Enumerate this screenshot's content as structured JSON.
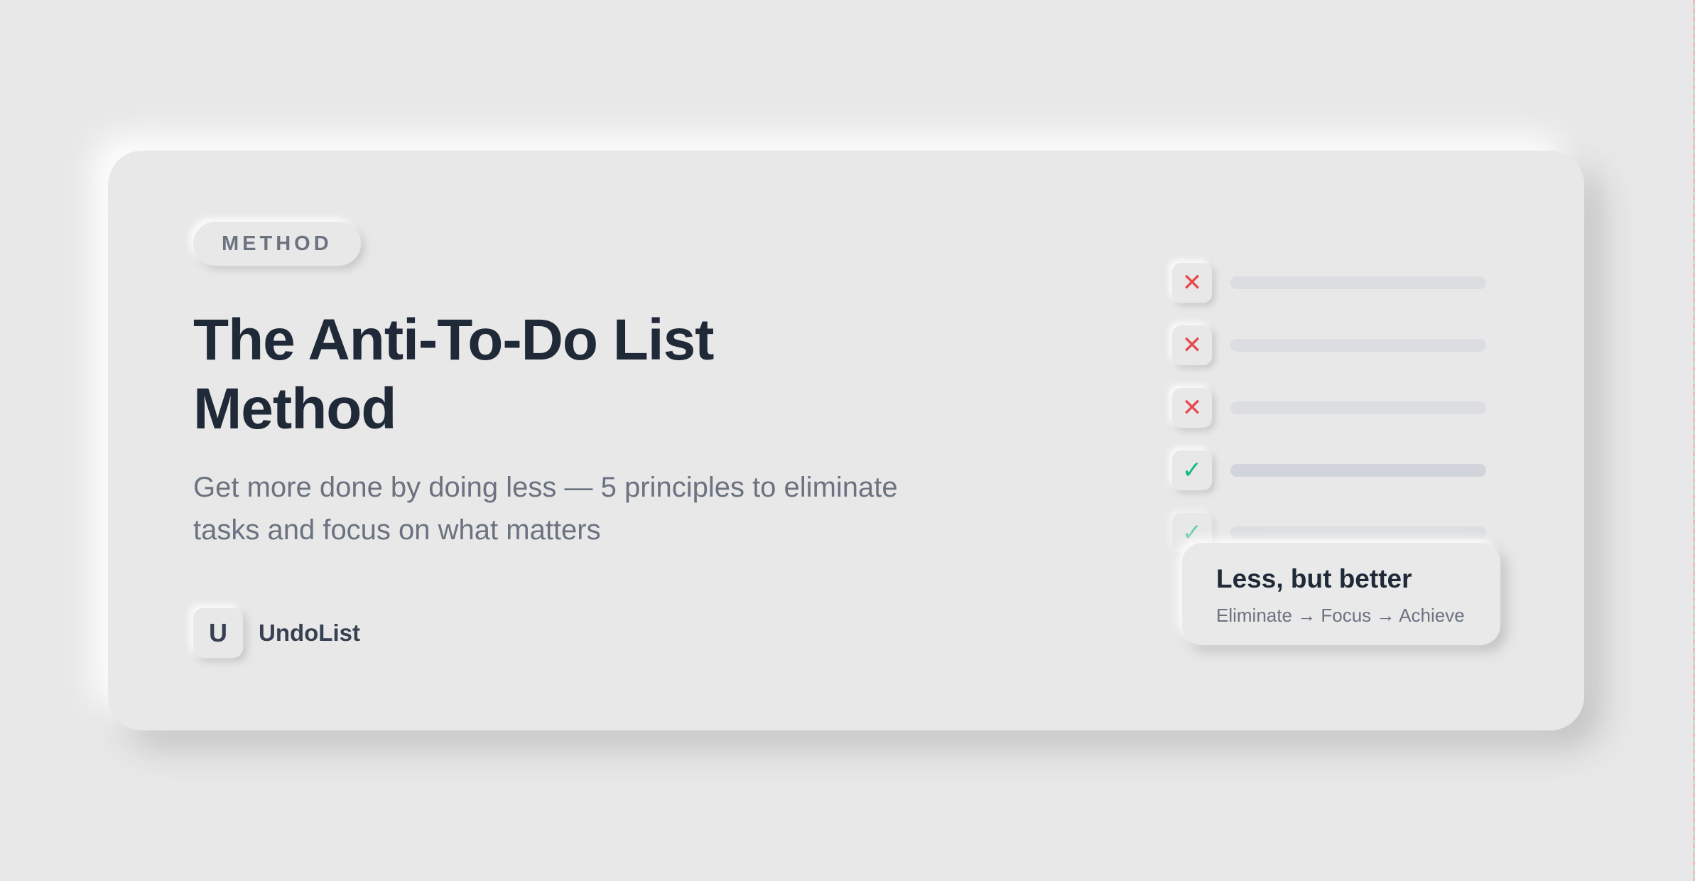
{
  "card": {
    "badge": "METHOD",
    "title": "The Anti-To-Do List Method",
    "subtitle": "Get more done by doing less — 5 principles to eliminate tasks and focus on what matters",
    "brand": {
      "logo_letter": "U",
      "name": "UndoList"
    }
  },
  "checklist": {
    "items": [
      {
        "status": "eliminated",
        "icon": "x-icon"
      },
      {
        "status": "eliminated",
        "icon": "x-icon"
      },
      {
        "status": "eliminated",
        "icon": "x-icon"
      },
      {
        "status": "done",
        "icon": "check-icon"
      },
      {
        "status": "done",
        "icon": "check-icon"
      }
    ],
    "x_symbol": "✕",
    "check_symbol": "✓"
  },
  "callout": {
    "title": "Less, but better",
    "subtitle": "Eliminate → Focus → Achieve"
  },
  "colors": {
    "background": "#e8e8e8",
    "heading": "#1f2937",
    "muted": "#6b7280",
    "eliminate": "#e5484d",
    "done": "#10b981"
  }
}
